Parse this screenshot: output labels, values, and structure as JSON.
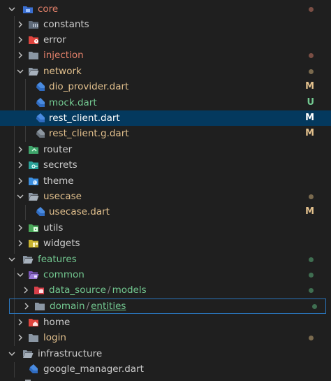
{
  "colors": {
    "modified": "#e2c08d",
    "untracked": "#73c991",
    "conflict": "#c74e39",
    "normal": "#cccccc",
    "muted_dot": "#8a7a6a"
  },
  "rows": [
    {
      "label": "core"
    },
    {
      "label": "constants"
    },
    {
      "label": "error"
    },
    {
      "label": "injection"
    },
    {
      "label": "network"
    },
    {
      "label": "dio_provider.dart",
      "badge": "M"
    },
    {
      "label": "mock.dart",
      "badge": "U"
    },
    {
      "label": "rest_client.dart",
      "badge": "M"
    },
    {
      "label": "rest_client.g.dart",
      "badge": "M"
    },
    {
      "label": "router"
    },
    {
      "label": "secrets"
    },
    {
      "label": "theme"
    },
    {
      "label": "usecase"
    },
    {
      "label": "usecase.dart",
      "badge": "M"
    },
    {
      "label": "utils"
    },
    {
      "label": "widgets"
    },
    {
      "label": "features"
    },
    {
      "label": "common"
    },
    {
      "label_a": "data_source",
      "separator": "/",
      "label_b": "models"
    },
    {
      "label_a": "domain",
      "separator": "/",
      "label_b": "entities"
    },
    {
      "label": "home"
    },
    {
      "label": "login"
    },
    {
      "label": "infrastructure"
    },
    {
      "label": "google_manager.dart"
    }
  ]
}
